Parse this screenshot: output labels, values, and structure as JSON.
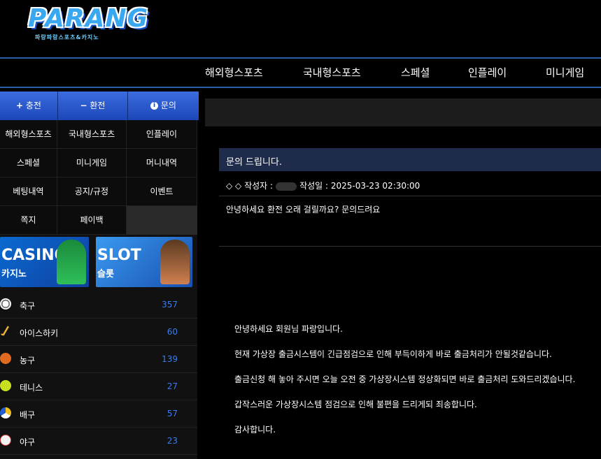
{
  "brand": {
    "logo_text": "PARANG",
    "logo_sub": "파랑파랑스포츠&카지노"
  },
  "nav": [
    "해외형스포츠",
    "국내형스포츠",
    "스페셜",
    "인플레이",
    "미니게임"
  ],
  "actions": [
    {
      "icon": "plus-icon",
      "glyph": "+",
      "label": "충전"
    },
    {
      "icon": "minus-icon",
      "glyph": "−",
      "label": "환전"
    },
    {
      "icon": "info-icon",
      "glyph": "i",
      "label": "문의"
    }
  ],
  "menu": [
    "해외형스포츠",
    "국내형스포츠",
    "인플레이",
    "스페셜",
    "미니게임",
    "머니내역",
    "베팅내역",
    "공지/규정",
    "이벤트",
    "쪽지",
    "페이백"
  ],
  "banners": [
    {
      "title": "CASINO",
      "sub": "카지노"
    },
    {
      "title": "SLOT",
      "sub": "슬롯"
    }
  ],
  "sports": [
    {
      "name": "축구",
      "count": "357",
      "icon": "soccer-ball-icon"
    },
    {
      "name": "아이스하키",
      "count": "60",
      "icon": "hockey-stick-icon"
    },
    {
      "name": "농구",
      "count": "139",
      "icon": "basketball-icon"
    },
    {
      "name": "테니스",
      "count": "27",
      "icon": "tennis-ball-icon"
    },
    {
      "name": "배구",
      "count": "57",
      "icon": "volleyball-icon"
    },
    {
      "name": "야구",
      "count": "23",
      "icon": "baseball-icon"
    }
  ],
  "post": {
    "title": "문의 드립니다.",
    "meta_prefix": "◇ ◇ 작성자 :",
    "meta_date": "작성일 : 2025-03-23 02:30:00",
    "question": "안녕하세요 환전 오래 걸릴까요? 문의드려요",
    "reply": [
      "안녕하세요 회원님 파랑입니다.",
      "현재 가상장 출금시스템이 긴급점검으로 인해 부득이하게 바로 출금처리가 안될것같습니다.",
      "출금신청 해 놓아 주시면 오늘 오전 중 가상장시스템 정상화되면 바로 출금처리 도와드리겠습니다.",
      "갑작스러운 가상장시스템 점검으로 인해 불편을 드리게되 죄송합니다.",
      "감사합니다."
    ]
  }
}
